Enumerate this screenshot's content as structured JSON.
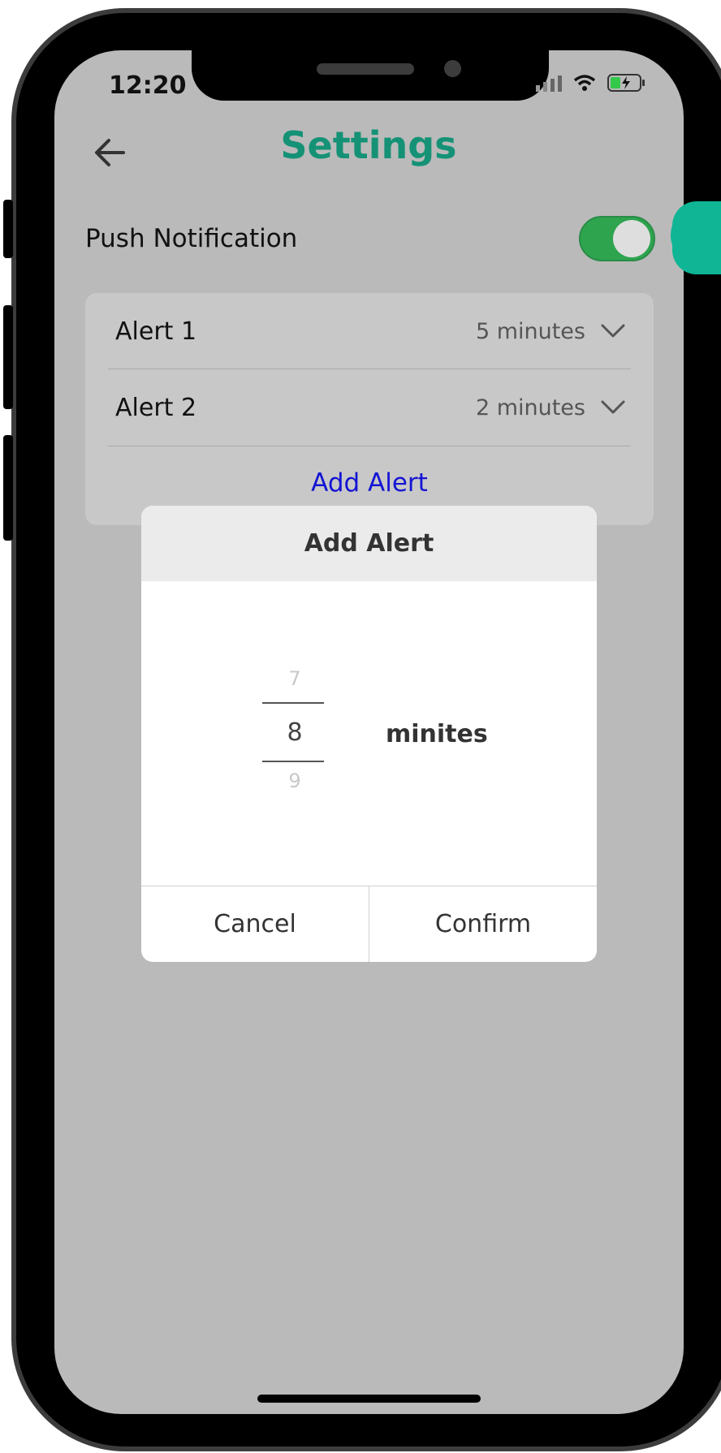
{
  "status_bar": {
    "time": "12:20"
  },
  "header": {
    "title": "Settings",
    "back_icon": "arrow-left-icon"
  },
  "push_notification": {
    "label": "Push Notification",
    "enabled": true
  },
  "alerts": [
    {
      "name": "Alert 1",
      "value": "5 minutes"
    },
    {
      "name": "Alert 2",
      "value": "2 minutes"
    }
  ],
  "add_alert_link": "Add Alert",
  "modal": {
    "title": "Add Alert",
    "picker": {
      "prev": "7",
      "selected": "8",
      "next": "9"
    },
    "unit": "minites",
    "cancel_label": "Cancel",
    "confirm_label": "Confirm"
  },
  "colors": {
    "accent": "#159276",
    "toggle_on": "#2ea44f",
    "link": "#1414d4",
    "overlay_bg": "#bababa"
  }
}
